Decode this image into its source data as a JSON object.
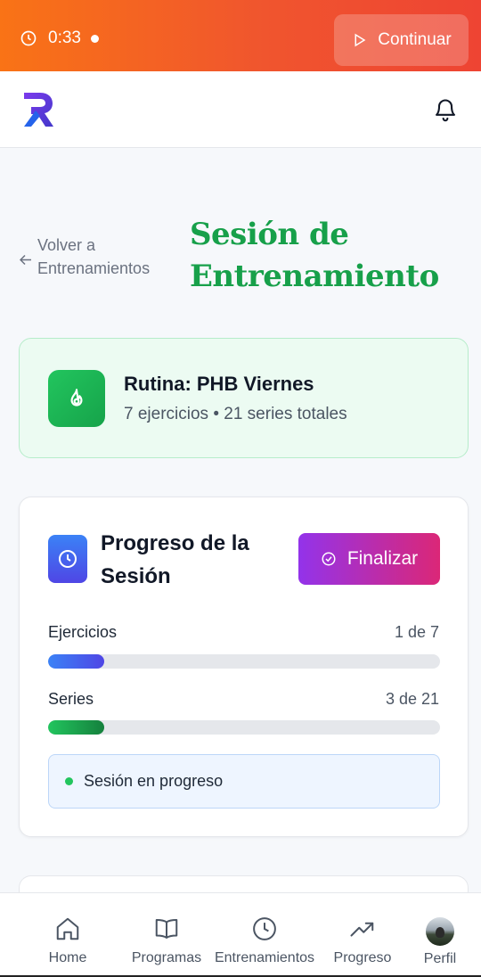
{
  "banner": {
    "timer": "0:33",
    "continue_label": "Continuar",
    "colors": {
      "start": "#f97316",
      "end": "#ee4433"
    }
  },
  "header": {
    "logo_icon": "brand-r-logo",
    "notification_icon": "bell-icon"
  },
  "page": {
    "back_line1": "Volver a",
    "back_line2": "Entrenamientos",
    "title": "Sesión de Entrenamiento"
  },
  "routine": {
    "icon": "flame-icon",
    "title": "Rutina: PHB Viernes",
    "exercises": "7 ejercicios",
    "separator": "•",
    "series_total": "21 series totales"
  },
  "progress": {
    "icon": "clock-icon",
    "title": "Progreso de la Sesión",
    "finish_label": "Finalizar",
    "metrics": [
      {
        "label": "Ejercicios",
        "value": "1 de 7",
        "fraction": 0.143
      },
      {
        "label": "Series",
        "value": "3 de 21",
        "fraction": 0.143
      }
    ],
    "status": "Sesión en progreso"
  },
  "nav": {
    "items": [
      {
        "label": "Home",
        "icon": "home-icon"
      },
      {
        "label": "Programas",
        "icon": "book-icon"
      },
      {
        "label": "Entrenamientos",
        "icon": "clock-icon"
      },
      {
        "label": "Progreso",
        "icon": "trending-up-icon"
      },
      {
        "label": "Perfil",
        "icon": "avatar"
      }
    ]
  },
  "colors": {
    "accent_green": "#17a04a",
    "accent_blue": "#4f46e5",
    "accent_purple": "#9333ea",
    "accent_pink": "#db2777"
  }
}
